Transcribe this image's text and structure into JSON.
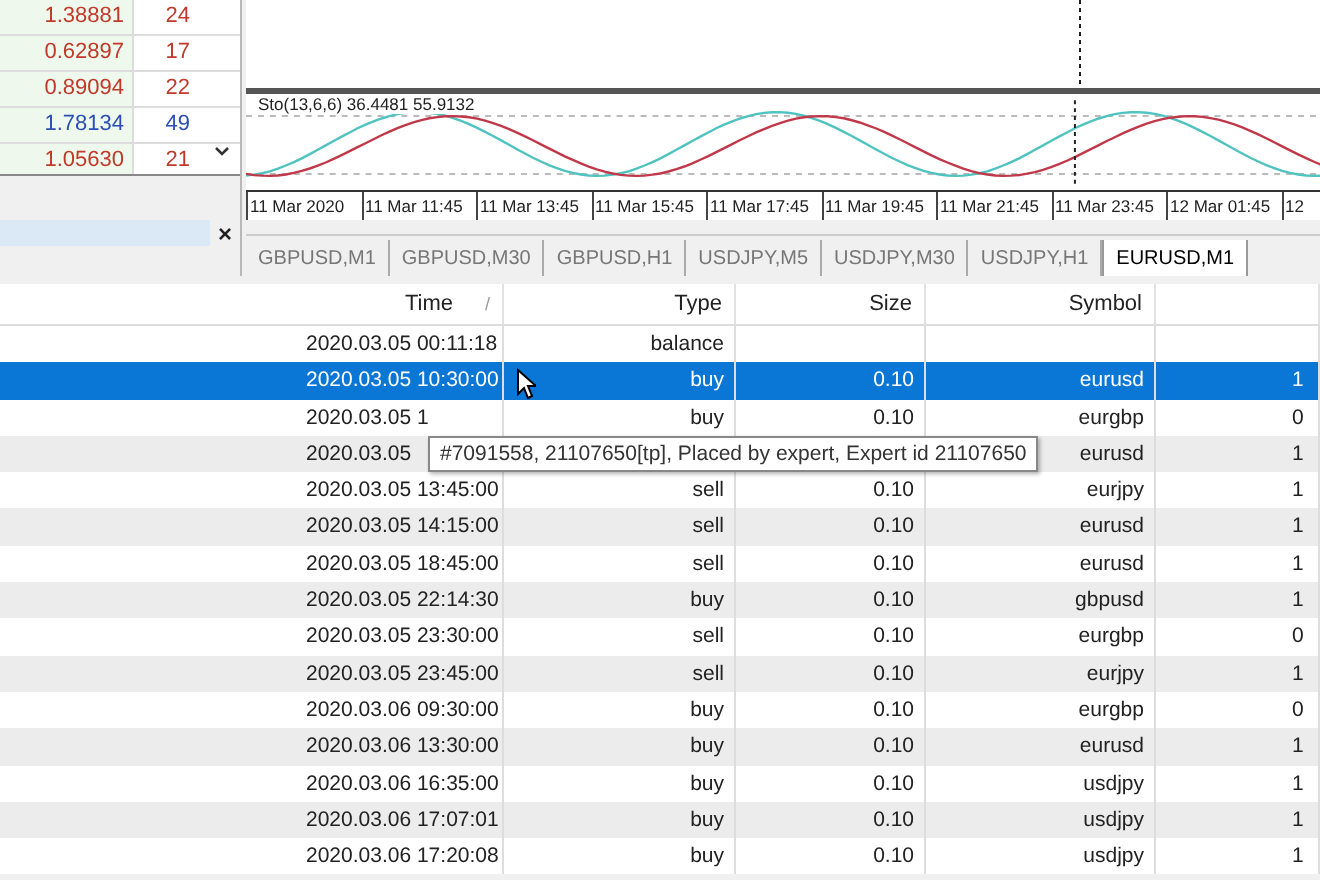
{
  "market_watch": {
    "rows": [
      {
        "price": "1.38881",
        "spread": "24",
        "color": "#c0392b"
      },
      {
        "price": "0.62897",
        "spread": "17",
        "color": "#c0392b"
      },
      {
        "price": "0.89094",
        "spread": "22",
        "color": "#c0392b"
      },
      {
        "price": "1.78134",
        "spread": "49",
        "color": "#2c4fb5"
      },
      {
        "price": "1.05630",
        "spread": "21",
        "color": "#c0392b"
      }
    ],
    "close": "×"
  },
  "chart": {
    "indicator_label": "Sto(13,6,6) 36.4481 55.9132",
    "time_axis": [
      "11 Mar 2020",
      "11 Mar 11:45",
      "11 Mar 13:45",
      "11 Mar 15:45",
      "11 Mar 17:45",
      "11 Mar 19:45",
      "11 Mar 21:45",
      "11 Mar 23:45",
      "12 Mar 01:45",
      "12"
    ],
    "tabs": [
      {
        "label": "GBPUSD,M1",
        "selected": false
      },
      {
        "label": "GBPUSD,M30",
        "selected": false
      },
      {
        "label": "GBPUSD,H1",
        "selected": false
      },
      {
        "label": "USDJPY,M5",
        "selected": false
      },
      {
        "label": "USDJPY,M30",
        "selected": false
      },
      {
        "label": "USDJPY,H1",
        "selected": false
      },
      {
        "label": "EURUSD,M1",
        "selected": true
      }
    ]
  },
  "table": {
    "columns": [
      "Time",
      "Type",
      "Size",
      "Symbol"
    ],
    "sort_mark": "/",
    "rows": [
      {
        "time": "2020.03.05 00:11:18",
        "type": "balance",
        "size": "",
        "symbol": "",
        "column_5": "",
        "selected": false
      },
      {
        "time": "2020.03.05 10:30:00",
        "type": "buy",
        "size": "0.10",
        "symbol": "eurusd",
        "column_5": "1",
        "selected": true
      },
      {
        "time": "2020.03.05 1",
        "type": "buy",
        "size": "0.10",
        "symbol": "eurgbp",
        "column_5": "0",
        "selected": false
      },
      {
        "time": "2020.03.05",
        "type": "",
        "size": "",
        "symbol": "eurusd",
        "column_5": "1",
        "selected": false
      },
      {
        "time": "2020.03.05 13:45:00",
        "type": "sell",
        "size": "0.10",
        "symbol": "eurjpy",
        "column_5": "1",
        "selected": false
      },
      {
        "time": "2020.03.05 14:15:00",
        "type": "sell",
        "size": "0.10",
        "symbol": "eurusd",
        "column_5": "1",
        "selected": false
      },
      {
        "time": "2020.03.05 18:45:00",
        "type": "sell",
        "size": "0.10",
        "symbol": "eurusd",
        "column_5": "1",
        "selected": false
      },
      {
        "time": "2020.03.05 22:14:30",
        "type": "buy",
        "size": "0.10",
        "symbol": "gbpusd",
        "column_5": "1",
        "selected": false
      },
      {
        "time": "2020.03.05 23:30:00",
        "type": "sell",
        "size": "0.10",
        "symbol": "eurgbp",
        "column_5": "0",
        "selected": false
      },
      {
        "time": "2020.03.05 23:45:00",
        "type": "sell",
        "size": "0.10",
        "symbol": "eurjpy",
        "column_5": "1",
        "selected": false
      },
      {
        "time": "2020.03.06 09:30:00",
        "type": "buy",
        "size": "0.10",
        "symbol": "eurgbp",
        "column_5": "0",
        "selected": false
      },
      {
        "time": "2020.03.06 13:30:00",
        "type": "buy",
        "size": "0.10",
        "symbol": "eurusd",
        "column_5": "1",
        "selected": false
      },
      {
        "time": "2020.03.06 16:35:00",
        "type": "buy",
        "size": "0.10",
        "symbol": "usdjpy",
        "column_5": "1",
        "selected": false
      },
      {
        "time": "2020.03.06 17:07:01",
        "type": "buy",
        "size": "0.10",
        "symbol": "usdjpy",
        "column_5": "1",
        "selected": false
      },
      {
        "time": "2020.03.06 17:20:08",
        "type": "buy",
        "size": "0.10",
        "symbol": "usdjpy",
        "column_5": "1",
        "selected": false
      }
    ]
  },
  "tooltip": {
    "text": "#7091558, 21107650[tp], Placed by expert, Expert id 21107650"
  }
}
